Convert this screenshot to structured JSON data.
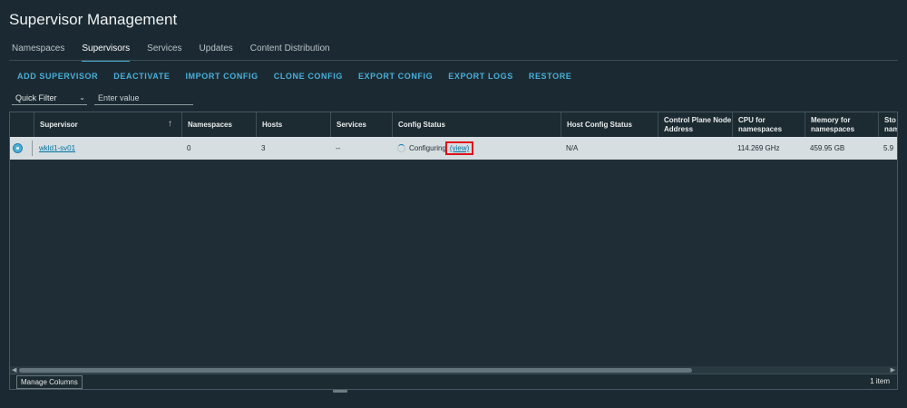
{
  "page": {
    "title": "Supervisor Management"
  },
  "tabs": [
    {
      "label": "Namespaces",
      "active": false
    },
    {
      "label": "Supervisors",
      "active": true
    },
    {
      "label": "Services",
      "active": false
    },
    {
      "label": "Updates",
      "active": false
    },
    {
      "label": "Content Distribution",
      "active": false
    }
  ],
  "actions": [
    "ADD SUPERVISOR",
    "DEACTIVATE",
    "IMPORT CONFIG",
    "CLONE CONFIG",
    "EXPORT CONFIG",
    "EXPORT LOGS",
    "RESTORE"
  ],
  "filter": {
    "quick_filter_label": "Quick Filter",
    "placeholder": "Enter value"
  },
  "table": {
    "columns": [
      "Supervisor",
      "Namespaces",
      "Hosts",
      "Services",
      "Config Status",
      "Host Config Status",
      "Control Plane Node Address",
      "CPU for namespaces",
      "Memory for namespaces",
      "Sto nam"
    ],
    "sort_indicator": "↑",
    "rows": [
      {
        "supervisor": "wkld1-sv01",
        "namespaces": "0",
        "hosts": "3",
        "services": "--",
        "config_status": "Configuring",
        "config_status_link": "(view)",
        "host_config_status": "N/A",
        "control_plane_node_address": "",
        "cpu": "114.269 GHz",
        "memory": "459.95 GB",
        "storage": "5.9"
      }
    ]
  },
  "footer": {
    "manage_columns": "Manage Columns",
    "item_count": "1 item"
  },
  "colors": {
    "accent": "#49afd9",
    "background": "#1b2a32",
    "row_selected": "#d6dee1",
    "highlight": "#e0121a"
  }
}
